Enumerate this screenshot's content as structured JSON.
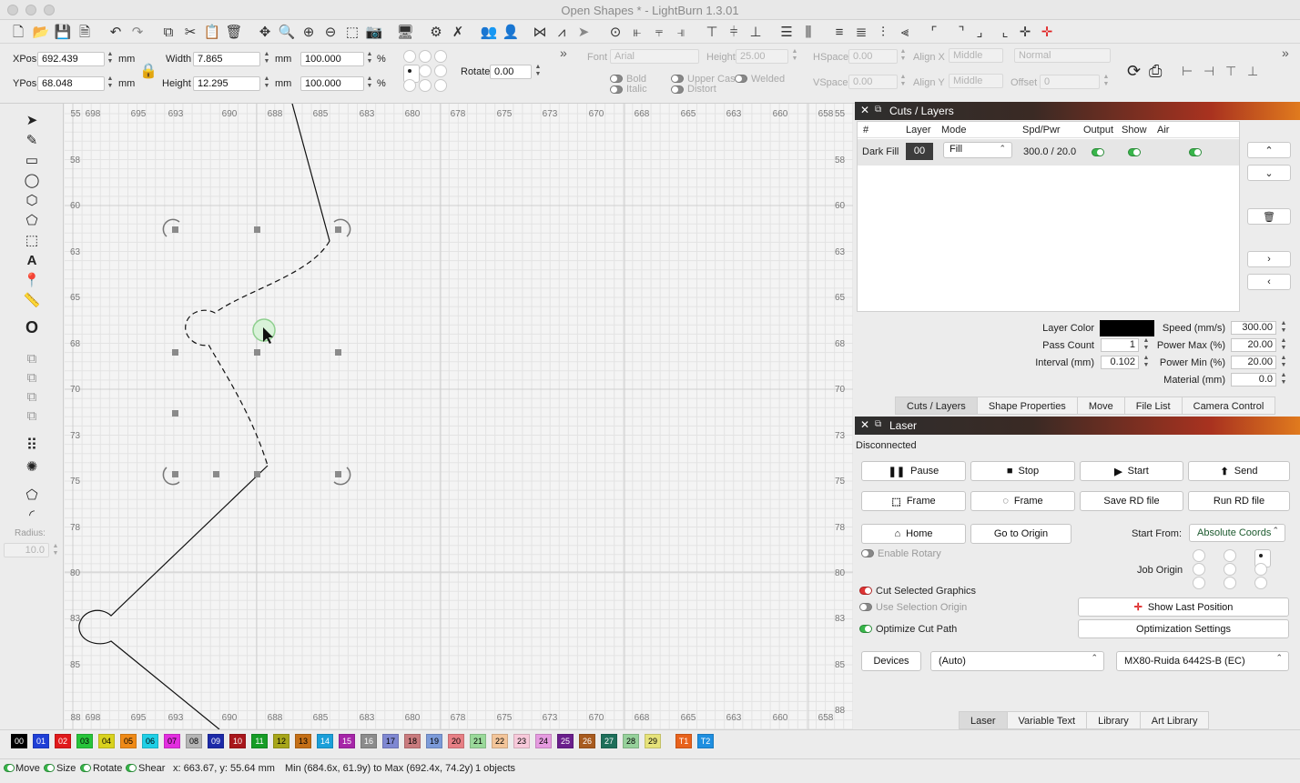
{
  "window": {
    "title": "Open Shapes * - LightBurn 1.3.01"
  },
  "props": {
    "xpos_label": "XPos",
    "xpos": "692.439",
    "ypos_label": "YPos",
    "ypos": "68.048",
    "unit": "mm",
    "width_label": "Width",
    "width": "7.865",
    "height_label": "Height",
    "height": "12.295",
    "scale_w": "100.000",
    "scale_h": "100.000",
    "pct": "%",
    "rotate_label": "Rotate",
    "rotate": "0.00",
    "font_label": "Font",
    "font_value": "Arial",
    "fheight_label": "Height",
    "fheight": "25.00",
    "hspace_label": "HSpace",
    "hspace": "0.00",
    "vspace_label": "VSpace",
    "vspace": "0.00",
    "alignx_label": "Align X",
    "alignx": "Middle",
    "aligny_label": "Align Y",
    "aligny": "Middle",
    "normal": "Normal",
    "offset_label": "Offset",
    "offset": "0",
    "bold": "Bold",
    "italic": "Italic",
    "upper": "Upper Case",
    "welded": "Welded",
    "distort": "Distort"
  },
  "left_tools": {
    "radius_label": "Radius:",
    "radius": "10.0"
  },
  "ruler": {
    "top": [
      "55",
      "698",
      "695",
      "693",
      "690",
      "688",
      "685",
      "683",
      "680",
      "678",
      "675",
      "673",
      "670",
      "668",
      "665",
      "663",
      "660",
      "658"
    ],
    "bottom": [
      "88",
      "698",
      "695",
      "693",
      "690",
      "688",
      "685",
      "683",
      "680",
      "678",
      "675",
      "673",
      "670",
      "668",
      "665",
      "663",
      "660",
      "658"
    ],
    "left": [
      "58",
      "60",
      "63",
      "65",
      "68",
      "70",
      "73",
      "75",
      "78",
      "80",
      "83",
      "85"
    ],
    "right": [
      "55",
      "58",
      "60",
      "63",
      "65",
      "68",
      "70",
      "73",
      "75",
      "78",
      "80",
      "83",
      "85",
      "88"
    ]
  },
  "cuts": {
    "title": "Cuts / Layers",
    "headers": [
      "#",
      "Layer",
      "Mode",
      "Spd/Pwr",
      "Output",
      "Show",
      "Air"
    ],
    "row": {
      "name": "Dark Fill",
      "layer": "00",
      "mode": "Fill",
      "spdpwr": "300.0 / 20.0"
    },
    "layer_color_label": "Layer Color",
    "pass_count_label": "Pass Count",
    "pass_count": "1",
    "interval_label": "Interval (mm)",
    "interval": "0.102",
    "speed_label": "Speed (mm/s)",
    "speed": "300.00",
    "pmax_label": "Power Max (%)",
    "pmax": "20.00",
    "pmin_label": "Power Min (%)",
    "pmin": "20.00",
    "material_label": "Material (mm)",
    "material": "0.0",
    "layer_color": "#000000"
  },
  "tabs_top": [
    "Cuts / Layers",
    "Shape Properties",
    "Move",
    "File List",
    "Camera Control"
  ],
  "laser": {
    "title": "Laser",
    "status": "Disconnected",
    "pause": "Pause",
    "stop": "Stop",
    "start": "Start",
    "send": "Send",
    "frame1": "Frame",
    "frame2": "Frame",
    "save_rd": "Save RD file",
    "run_rd": "Run RD file",
    "home": "Home",
    "go_origin": "Go to Origin",
    "start_from_label": "Start From:",
    "start_from": "Absolute Coords",
    "enable_rotary": "Enable Rotary",
    "job_origin": "Job Origin",
    "cut_selected": "Cut Selected Graphics",
    "use_sel_origin": "Use Selection Origin",
    "optimize": "Optimize Cut Path",
    "show_last": "Show Last Position",
    "opt_settings": "Optimization Settings",
    "devices": "Devices",
    "port": "(Auto)",
    "device": "MX80-Ruida 6442S-B (EC)"
  },
  "tabs_bottom": [
    "Laser",
    "Variable Text",
    "Library",
    "Art Library"
  ],
  "palette": [
    {
      "label": "00",
      "color": "#000000",
      "text": "#ffffff"
    },
    {
      "label": "01",
      "color": "#1f3fd6",
      "text": "#ffffff"
    },
    {
      "label": "02",
      "color": "#e0191b",
      "text": "#ffffff"
    },
    {
      "label": "03",
      "color": "#27c43a",
      "text": "#000000"
    },
    {
      "label": "04",
      "color": "#d9d21e",
      "text": "#000000"
    },
    {
      "label": "05",
      "color": "#ef8a17",
      "text": "#000000"
    },
    {
      "label": "06",
      "color": "#1fcfe6",
      "text": "#000000"
    },
    {
      "label": "07",
      "color": "#e32ee0",
      "text": "#000000"
    },
    {
      "label": "08",
      "color": "#b5b5b5",
      "text": "#000000"
    },
    {
      "label": "09",
      "color": "#1c2aa8",
      "text": "#ffffff"
    },
    {
      "label": "10",
      "color": "#a8161b",
      "text": "#ffffff"
    },
    {
      "label": "11",
      "color": "#169c26",
      "text": "#ffffff"
    },
    {
      "label": "12",
      "color": "#a7a61a",
      "text": "#000000"
    },
    {
      "label": "13",
      "color": "#c46f17",
      "text": "#000000"
    },
    {
      "label": "14",
      "color": "#1b9fd9",
      "text": "#ffffff"
    },
    {
      "label": "15",
      "color": "#a626a8",
      "text": "#ffffff"
    },
    {
      "label": "16",
      "color": "#8c8c8c",
      "text": "#ffffff"
    },
    {
      "label": "17",
      "color": "#7f88d2",
      "text": "#000000"
    },
    {
      "label": "18",
      "color": "#c97b7e",
      "text": "#000000"
    },
    {
      "label": "19",
      "color": "#7c9bd9",
      "text": "#000000"
    },
    {
      "label": "20",
      "color": "#e77f85",
      "text": "#000000"
    },
    {
      "label": "21",
      "color": "#9ad99a",
      "text": "#000000"
    },
    {
      "label": "22",
      "color": "#f3c59a",
      "text": "#000000"
    },
    {
      "label": "23",
      "color": "#f7c9da",
      "text": "#000000"
    },
    {
      "label": "24",
      "color": "#e59be0",
      "text": "#000000"
    },
    {
      "label": "25",
      "color": "#6a1f8c",
      "text": "#ffffff"
    },
    {
      "label": "26",
      "color": "#a85b1f",
      "text": "#ffffff"
    },
    {
      "label": "27",
      "color": "#1e6f5a",
      "text": "#ffffff"
    },
    {
      "label": "28",
      "color": "#96d19b",
      "text": "#000000"
    },
    {
      "label": "29",
      "color": "#e6e27a",
      "text": "#000000"
    },
    {
      "label": "T1",
      "color": "#e8621c",
      "text": "#ffffff"
    },
    {
      "label": "T2",
      "color": "#1f8fe0",
      "text": "#ffffff"
    }
  ],
  "status": {
    "move": "Move",
    "size": "Size",
    "rotate": "Rotate",
    "shear": "Shear",
    "coords": "x: 663.67, y: 55.64 mm",
    "range": "Min (684.6x, 61.9y) to Max (692.4x, 74.2y)",
    "count": "1 objects"
  },
  "colors": {
    "accent_green": "#38b54a",
    "panel_gradient_end": "#e07a1e"
  }
}
